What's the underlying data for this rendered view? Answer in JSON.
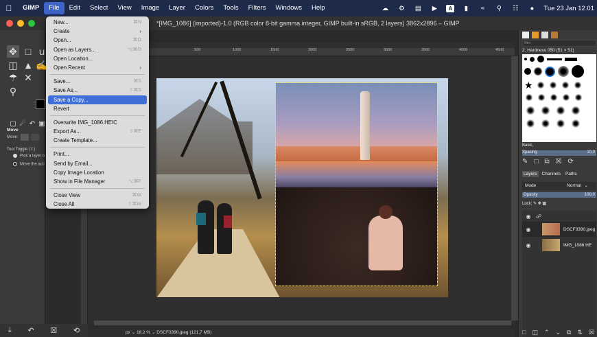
{
  "menubar": {
    "app": "GIMP",
    "items": [
      "File",
      "Edit",
      "Select",
      "View",
      "Image",
      "Layer",
      "Colors",
      "Tools",
      "Filters",
      "Windows",
      "Help"
    ],
    "input_label": "A",
    "clock": "Tue 23 Jan  12.01"
  },
  "window": {
    "title": "*[IMG_1086] (imported)-1.0 (RGB color 8-bit gamma integer, GIMP built-in sRGB, 2 layers) 3862x2896 – GIMP"
  },
  "file_menu": {
    "items": [
      {
        "label": "New...",
        "shortcut": "⌘N"
      },
      {
        "label": "Create",
        "submenu": true
      },
      {
        "label": "Open...",
        "shortcut": "⌘O"
      },
      {
        "label": "Open as Layers...",
        "shortcut": "⌥⌘O"
      },
      {
        "label": "Open Location...",
        "shortcut": ""
      },
      {
        "label": "Open Recent",
        "submenu": true
      },
      {
        "label": "Save...",
        "shortcut": "⌘S"
      },
      {
        "label": "Save As...",
        "shortcut": "⇧⌘S"
      },
      {
        "label": "Save a Copy...",
        "shortcut": "",
        "highlighted": true
      },
      {
        "label": "Revert",
        "shortcut": ""
      },
      {
        "label": "Overwrite IMG_1086.HEIC",
        "shortcut": ""
      },
      {
        "label": "Export As...",
        "shortcut": "⇧⌘E"
      },
      {
        "label": "Create Template...",
        "shortcut": ""
      },
      {
        "label": "Print...",
        "shortcut": ""
      },
      {
        "label": "Send by Email...",
        "shortcut": ""
      },
      {
        "label": "Copy Image Location",
        "shortcut": ""
      },
      {
        "label": "Show in File Manager",
        "shortcut": "⌥⌘F"
      },
      {
        "label": "Close View",
        "shortcut": "⌘W"
      },
      {
        "label": "Close All",
        "shortcut": "⇧⌘W"
      }
    ]
  },
  "toolbox": {
    "options_title": "Move",
    "move_label": "Move:",
    "tool_toggle": "Tool Toggle  (⇧)",
    "option_pick_layer": "Pick a layer o",
    "option_move_active": "Move the acti"
  },
  "ruler": {
    "ticks": [
      "500",
      "1000",
      "1500",
      "2000",
      "2500",
      "3000",
      "3500",
      "4000",
      "4500"
    ]
  },
  "status": {
    "unit": "px",
    "zoom": "18.2 %",
    "layer_info": "DSCF3390.jpeg (121,7 MB)"
  },
  "brushes": {
    "filter_placeholder": "filter",
    "current": "2. Hardness 050 (51 × 51)",
    "preset": "Basic,",
    "spacing_label": "Spacing",
    "spacing_value": "10,0"
  },
  "layers_panel": {
    "tabs": [
      "Layers",
      "Channels",
      "Paths"
    ],
    "mode_label": "Mode",
    "mode_value": "Normal",
    "opacity_label": "Opacity",
    "opacity_value": "100,0",
    "lock_label": "Lock:",
    "layers": [
      {
        "name": "DSCF3390.jpeg",
        "selected": true
      },
      {
        "name": "IMG_1086.HE",
        "selected": false
      }
    ]
  },
  "colors": {
    "menubar_bg": "#1d2a4a",
    "menu_highlight": "#3f6fd6",
    "selection_border": "#e6d95a"
  }
}
